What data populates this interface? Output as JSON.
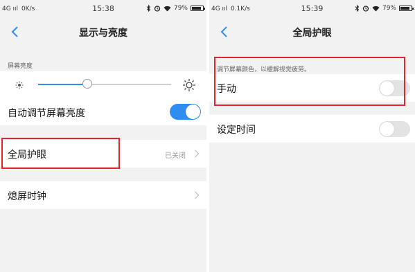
{
  "left_screen": {
    "status": {
      "signal": "4G ııl",
      "speed": "0K/s",
      "time": "15:38",
      "battery": "79%"
    },
    "title": "显示与亮度",
    "brightness_label": "屏幕亮度",
    "brightness_level": 0.37,
    "auto_brightness": {
      "label": "自动调节屏幕亮度",
      "on": true
    },
    "eye_protection": {
      "label": "全局护眼",
      "value": "已关闭"
    },
    "screen_off_clock": {
      "label": "熄屏时钟"
    }
  },
  "right_screen": {
    "status": {
      "signal": "4G ııl",
      "speed": "0.1K/s",
      "time": "15:39",
      "battery": "79%"
    },
    "title": "全局护眼",
    "description": "调节屏幕颜色，以缓解视觉疲劳。",
    "manual": {
      "label": "手动",
      "on": false
    },
    "schedule": {
      "label": "设定时间",
      "on": false
    }
  },
  "colors": {
    "accent": "#2f8df2",
    "highlight": "#e0262c",
    "background": "#f2f2f2"
  },
  "icons": [
    "back-arrow-icon",
    "bluetooth-icon",
    "alarm-icon",
    "wifi-icon",
    "battery-icon",
    "sun-small-icon",
    "sun-large-icon",
    "chevron-right-icon"
  ]
}
